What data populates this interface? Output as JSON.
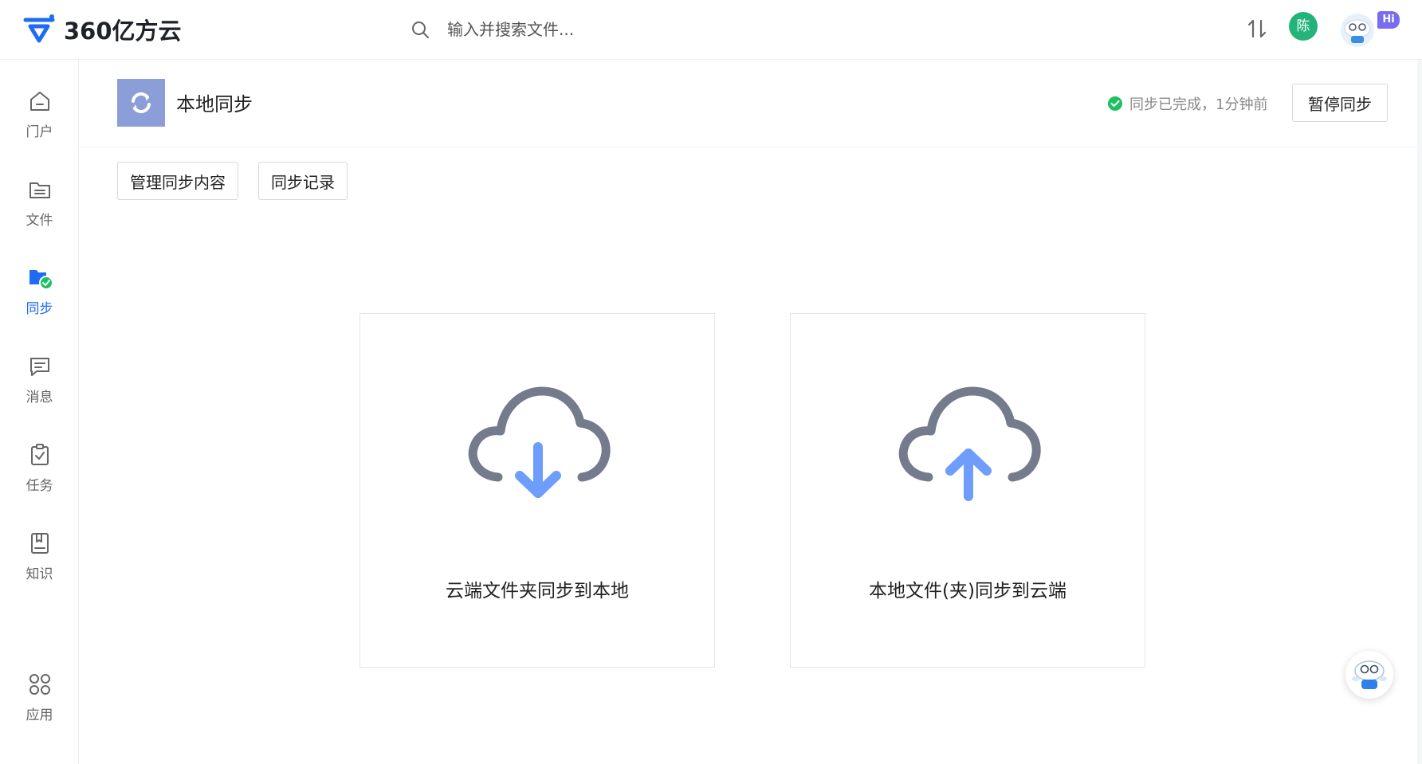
{
  "app": {
    "logo_text": "360亿方云",
    "colors": {
      "accent": "#1f6bf2",
      "success": "#1fbf63",
      "icon_gray": "#737b8c",
      "arrow_blue": "#6e9dfb"
    }
  },
  "topbar": {
    "search_placeholder": "输入并搜索文件...",
    "user_initial": "陈",
    "hi_badge": "Hi",
    "icons": [
      "search-icon",
      "transfer-icon",
      "assistant-avatar-icon"
    ]
  },
  "sidebar": {
    "items": [
      {
        "label": "门户",
        "icon": "home-icon"
      },
      {
        "label": "文件",
        "icon": "folder-icon"
      },
      {
        "label": "同步",
        "icon": "sync-folder-icon",
        "active": true
      },
      {
        "label": "消息",
        "icon": "message-icon"
      },
      {
        "label": "任务",
        "icon": "task-icon"
      },
      {
        "label": "知识",
        "icon": "knowledge-icon"
      },
      {
        "label": "应用",
        "icon": "apps-icon"
      }
    ]
  },
  "main": {
    "title": "本地同步",
    "status_text": "同步已完成，1分钟前",
    "pause_button": "暂停同步",
    "toolbar": {
      "manage_button": "管理同步内容",
      "records_button": "同步记录"
    },
    "cards": [
      {
        "label": "云端文件夹同步到本地",
        "icon": "cloud-download-icon"
      },
      {
        "label": "本地文件(夹)同步到云端",
        "icon": "cloud-upload-icon"
      }
    ]
  }
}
